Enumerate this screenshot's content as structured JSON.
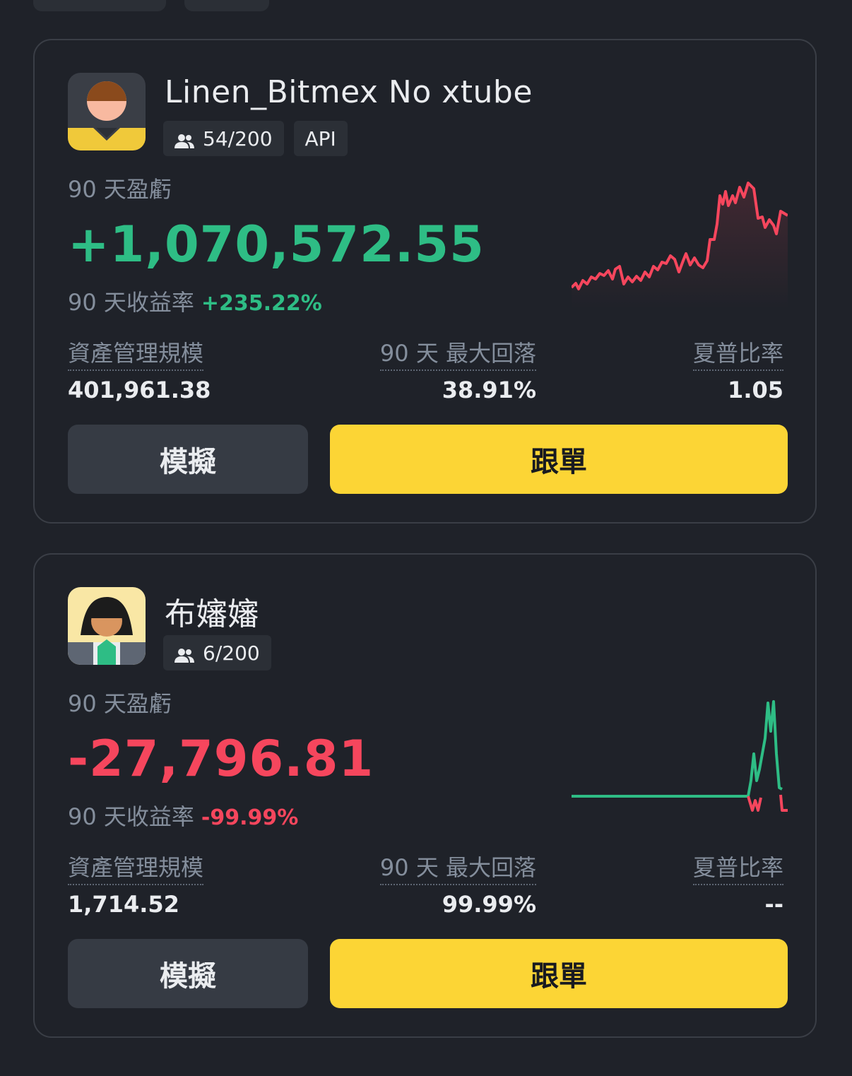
{
  "cards": [
    {
      "name": "Linen_Bitmex No xtube",
      "followers": "54/200",
      "api_badge": "API",
      "pnl_label": "90 天盈虧",
      "pnl_value": "+1,070,572.55",
      "roi_label": "90 天收益率",
      "roi_value": "+235.22%",
      "aum_label": "資產管理規模",
      "aum_value": "401,961.38",
      "mdd_label": "90 天 最大回落",
      "mdd_value": "38.91%",
      "sharpe_label": "夏普比率",
      "sharpe_value": "1.05",
      "simulate_label": "模擬",
      "copy_label": "跟單",
      "trend": "up",
      "color": "#2ebd85",
      "line_color": "#f6465d",
      "avatar_icon": "male-avatar-icon"
    },
    {
      "name": "布嬸嬸",
      "followers": "6/200",
      "pnl_label": "90 天盈虧",
      "pnl_value": "-27,796.81",
      "roi_label": "90 天收益率",
      "roi_value": "-99.99%",
      "aum_label": "資產管理規模",
      "aum_value": "1,714.52",
      "mdd_label": "90 天 最大回落",
      "mdd_value": "99.99%",
      "sharpe_label": "夏普比率",
      "sharpe_value": "--",
      "simulate_label": "模擬",
      "copy_label": "跟單",
      "trend": "down",
      "color": "#f6465d",
      "line_color": "#2ebd85",
      "avatar_icon": "female-avatar-icon"
    }
  ],
  "colors": {
    "background": "#1f2229",
    "card_border": "#3a3e46",
    "accent_yellow": "#fcd535",
    "secondary_button": "#363b44",
    "muted_text": "#848e9c"
  }
}
